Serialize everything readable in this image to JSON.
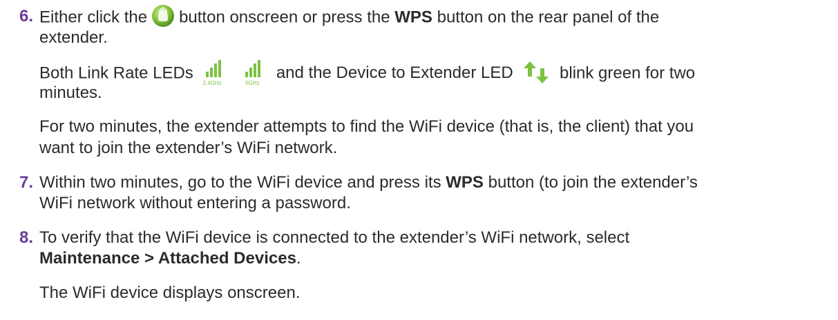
{
  "steps": [
    {
      "number": "6.",
      "text_before_icon": "Either click the",
      "icon": "wps-icon",
      "text_after_icon": "button onscreen or press the",
      "bold_1": "WPS",
      "text_after_bold": "button on the rear panel of the",
      "line2": "extender.",
      "para2_a": "Both Link Rate LEDs",
      "led_1_label": "2.4GHz",
      "led_2_label": "5GHz",
      "para2_b": "and the Device to Extender LED",
      "para2_c": "blink green for two",
      "para2_line2": "minutes.",
      "para3_line1": "For two minutes, the extender attempts to find the WiFi device (that is, the client) that you",
      "para3_line2": "want to join the extender’s WiFi network."
    },
    {
      "number": "7.",
      "line1_a": "Within two minutes, go to the WiFi device and press its",
      "bold_1": "WPS",
      "line1_b": "button (to join the extender’s",
      "line2": "WiFi network without entering a password."
    },
    {
      "number": "8.",
      "line1": "To verify that the WiFi device is connected to the extender’s WiFi network, select",
      "bold_line2": "Maintenance > Attached Devices",
      "line2_end": ".",
      "para2": "The WiFi device displays onscreen."
    }
  ],
  "colors": {
    "step_number": "#6a3e98",
    "text": "#2b2b2b",
    "led_green": "#7cc242",
    "wps_green": "#8dc63f"
  }
}
